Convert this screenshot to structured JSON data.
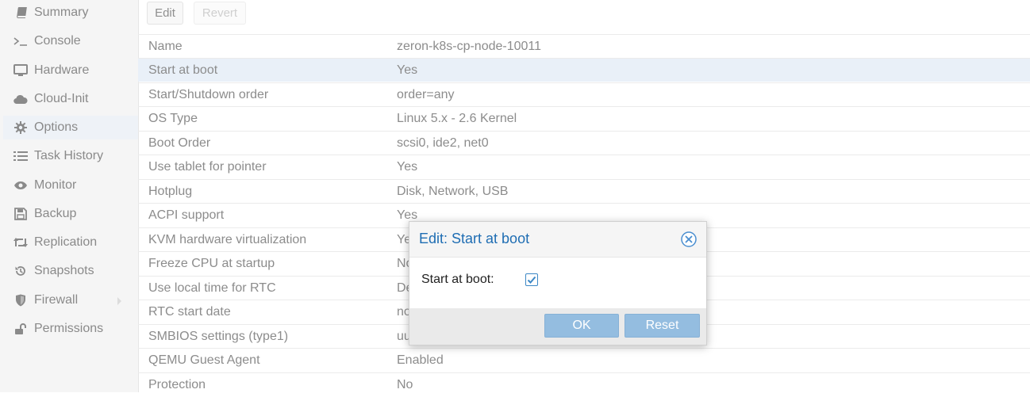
{
  "sidebar": {
    "items": [
      {
        "label": "Summary",
        "icon": "book-icon",
        "active": false
      },
      {
        "label": "Console",
        "icon": "terminal-icon",
        "active": false
      },
      {
        "label": "Hardware",
        "icon": "monitor-icon",
        "active": false
      },
      {
        "label": "Cloud-Init",
        "icon": "cloud-icon",
        "active": false
      },
      {
        "label": "Options",
        "icon": "gear-icon",
        "active": true
      },
      {
        "label": "Task History",
        "icon": "list-icon",
        "active": false
      },
      {
        "label": "Monitor",
        "icon": "eye-icon",
        "active": false
      },
      {
        "label": "Backup",
        "icon": "floppy-icon",
        "active": false
      },
      {
        "label": "Replication",
        "icon": "retweet-icon",
        "active": false
      },
      {
        "label": "Snapshots",
        "icon": "history-icon",
        "active": false
      },
      {
        "label": "Firewall",
        "icon": "shield-icon",
        "active": false,
        "has_submenu": true
      },
      {
        "label": "Permissions",
        "icon": "unlock-icon",
        "active": false
      }
    ]
  },
  "toolbar": {
    "edit_label": "Edit",
    "revert_label": "Revert"
  },
  "options": {
    "rows": [
      {
        "key": "Name",
        "value": "zeron-k8s-cp-node-10011",
        "selected": false
      },
      {
        "key": "Start at boot",
        "value": "Yes",
        "selected": true
      },
      {
        "key": "Start/Shutdown order",
        "value": "order=any",
        "selected": false
      },
      {
        "key": "OS Type",
        "value": "Linux 5.x - 2.6 Kernel",
        "selected": false
      },
      {
        "key": "Boot Order",
        "value": "scsi0, ide2, net0",
        "selected": false
      },
      {
        "key": "Use tablet for pointer",
        "value": "Yes",
        "selected": false
      },
      {
        "key": "Hotplug",
        "value": "Disk, Network, USB",
        "selected": false
      },
      {
        "key": "ACPI support",
        "value": "Yes",
        "selected": false
      },
      {
        "key": "KVM hardware virtualization",
        "value": "Ye",
        "selected": false
      },
      {
        "key": "Freeze CPU at startup",
        "value": "No",
        "selected": false
      },
      {
        "key": "Use local time for RTC",
        "value": "De",
        "selected": false
      },
      {
        "key": "RTC start date",
        "value": "no",
        "selected": false
      },
      {
        "key": "SMBIOS settings (type1)",
        "value": "uu",
        "selected": false
      },
      {
        "key": "QEMU Guest Agent",
        "value": "Enabled",
        "selected": false
      },
      {
        "key": "Protection",
        "value": "No",
        "selected": false
      }
    ]
  },
  "dialog": {
    "title": "Edit: Start at boot",
    "field_label": "Start at boot:",
    "checked": true,
    "ok_label": "OK",
    "reset_label": "Reset",
    "accent_color": "#1e6db3"
  },
  "colors": {
    "selected_row": "#e9f0f8",
    "button_blue": "#94bde0",
    "muted_text": "#8c8c8c"
  }
}
